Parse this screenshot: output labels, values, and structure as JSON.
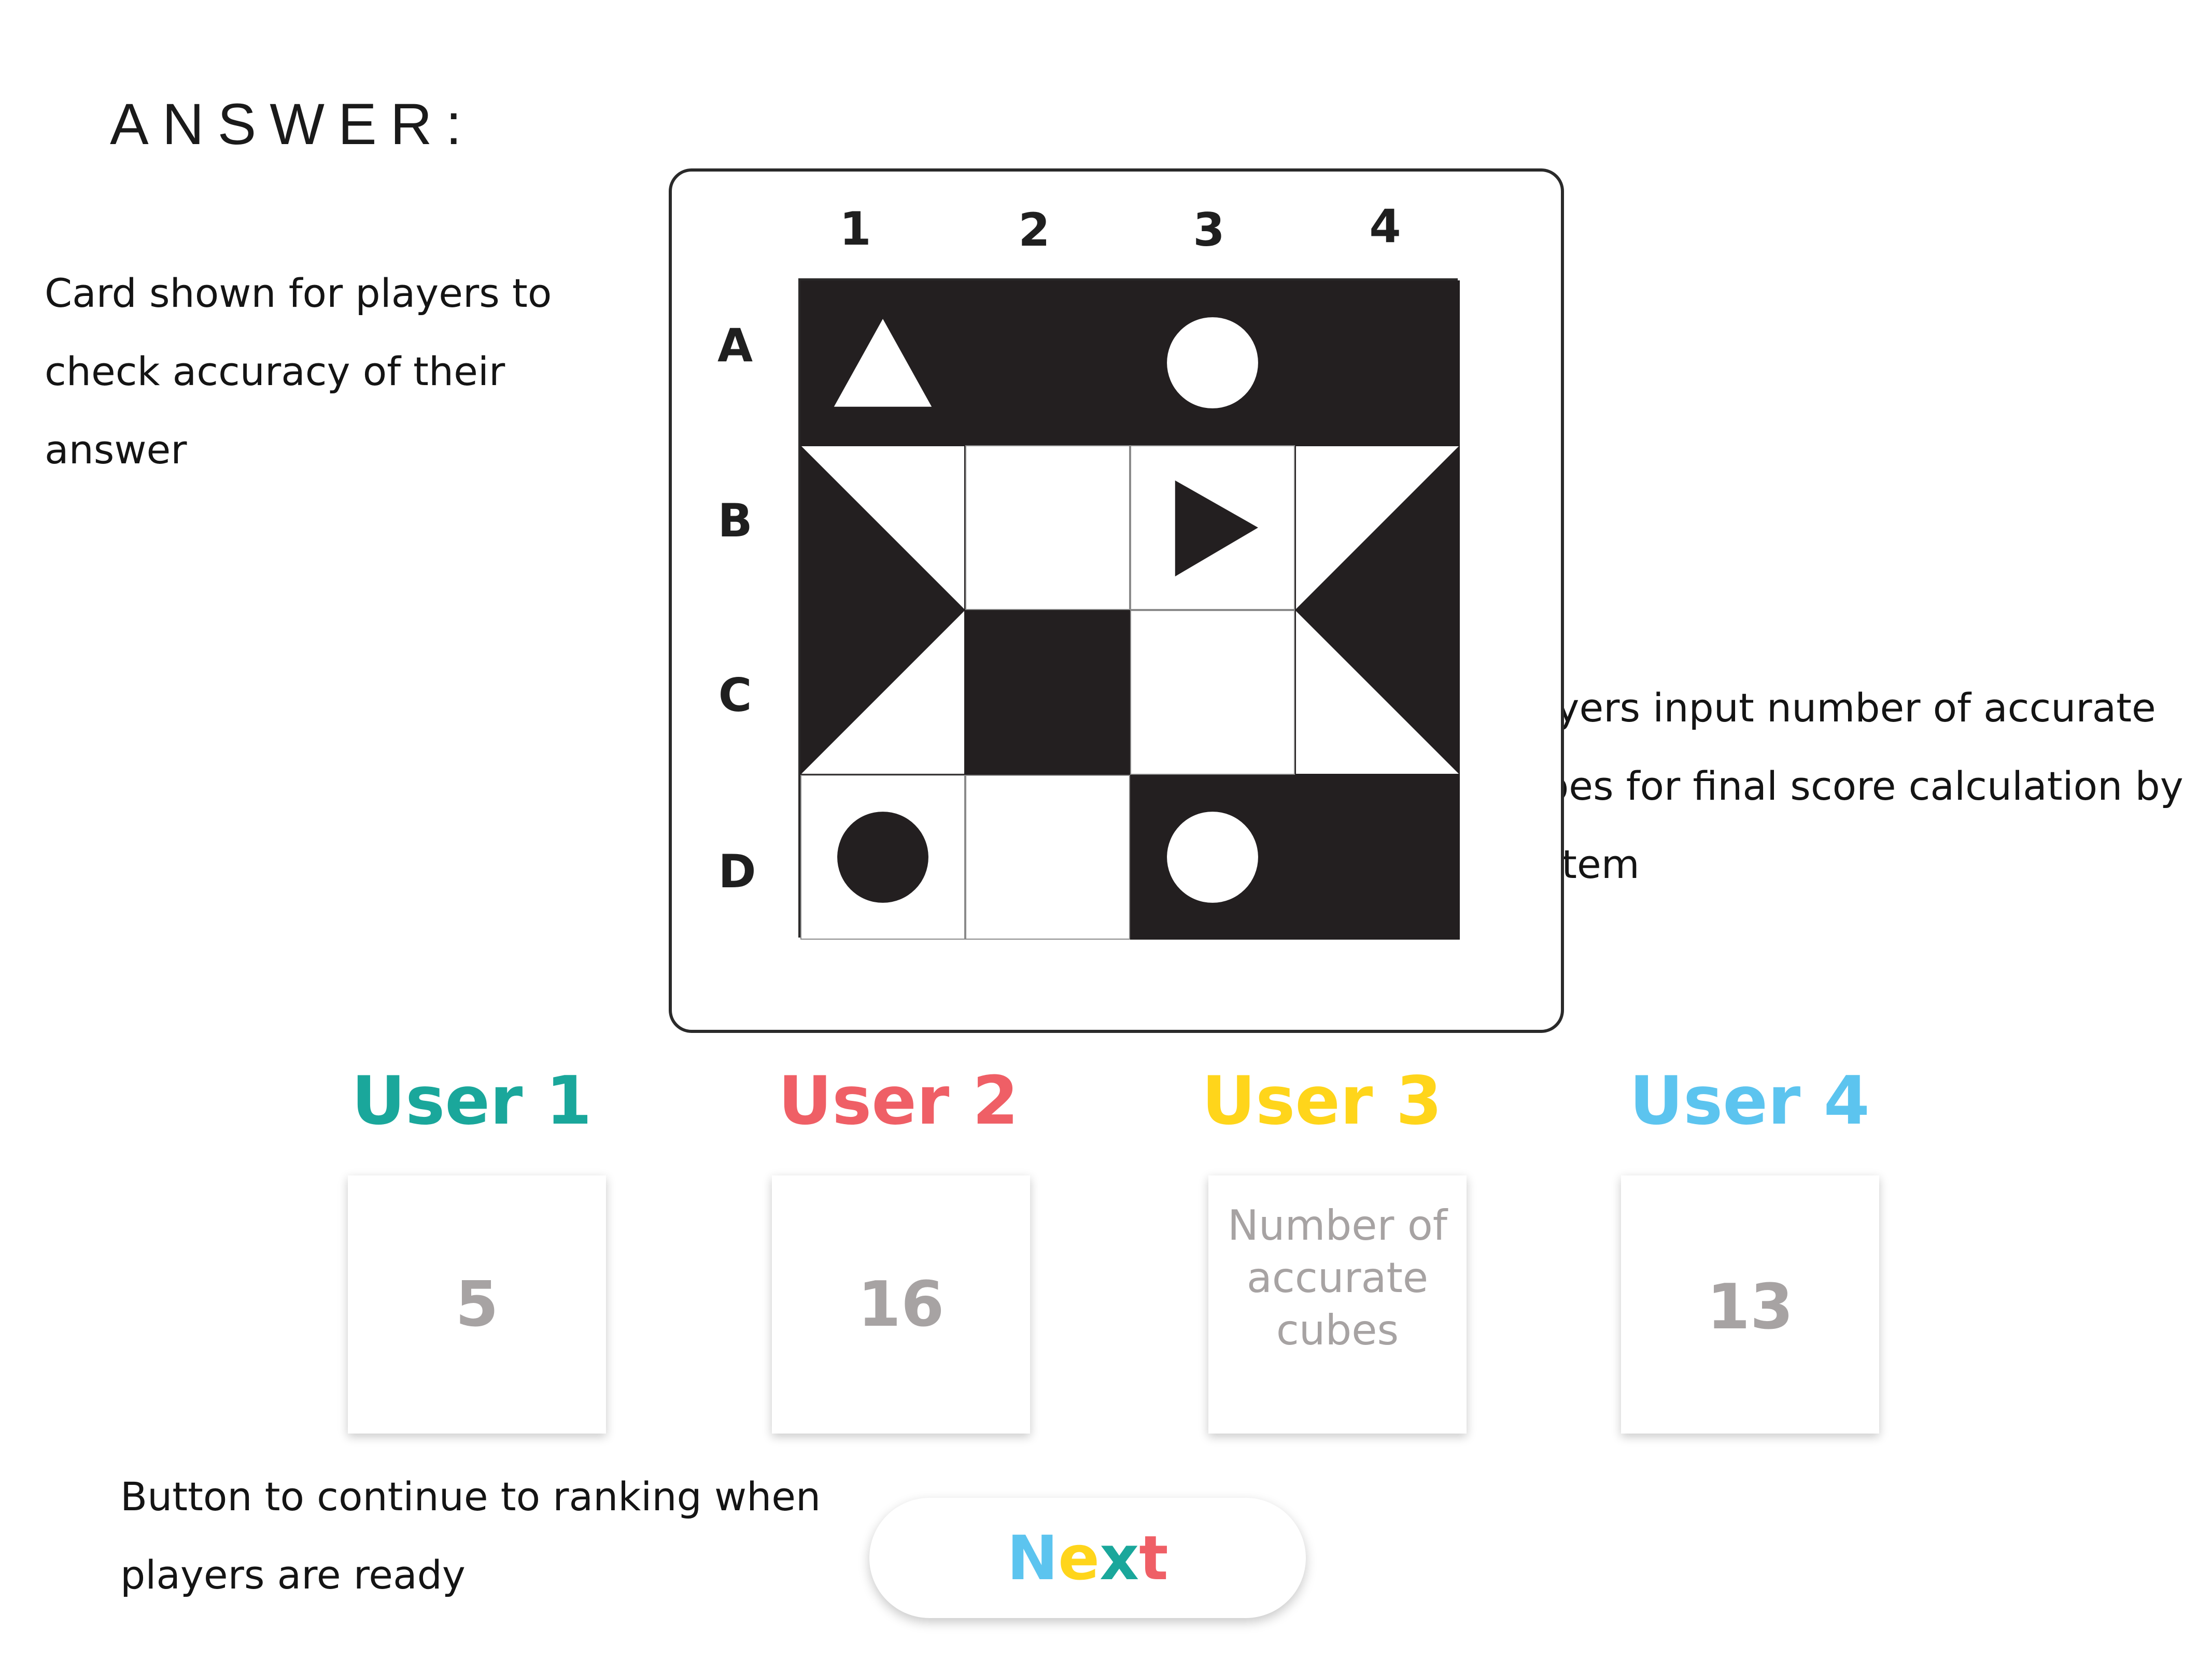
{
  "heading": "ANSWER:",
  "notes": {
    "card": "Card shown for players to check accuracy of their answer",
    "input": "Players input number of accurate cubes for final score calculation by system",
    "button": "Button to continue to ranking when players are ready"
  },
  "card": {
    "columns": [
      "1",
      "2",
      "3",
      "4"
    ],
    "rows": [
      "A",
      "B",
      "C",
      "D"
    ],
    "cells": [
      [
        "dark-white-triangle-up",
        "dark",
        "dark-white-circle",
        "dark"
      ],
      [
        "light-black-triangle-left",
        "light",
        "light-black-triangle-right",
        "light-black-triangle-right-edge"
      ],
      [
        "light-black-triangle-left-bottom",
        "dark",
        "light",
        "light-black-triangle-right-bottom"
      ],
      [
        "light-black-circle",
        "light",
        "dark-white-circle",
        "dark"
      ]
    ]
  },
  "users": [
    {
      "label": "User 1",
      "color": "#1aa79b",
      "value": "5",
      "placeholder": ""
    },
    {
      "label": "User 2",
      "color": "#ef5f66",
      "value": "16",
      "placeholder": ""
    },
    {
      "label": "User 3",
      "color": "#ffd51b",
      "value": "",
      "placeholder": "Number of accurate cubes"
    },
    {
      "label": "User 4",
      "color": "#5cc4ef",
      "value": "13",
      "placeholder": ""
    }
  ],
  "next_button": {
    "label": "Next",
    "letter_colors": [
      "#5cc4ef",
      "#ffd51b",
      "#1aa79b",
      "#ef5f66"
    ]
  }
}
